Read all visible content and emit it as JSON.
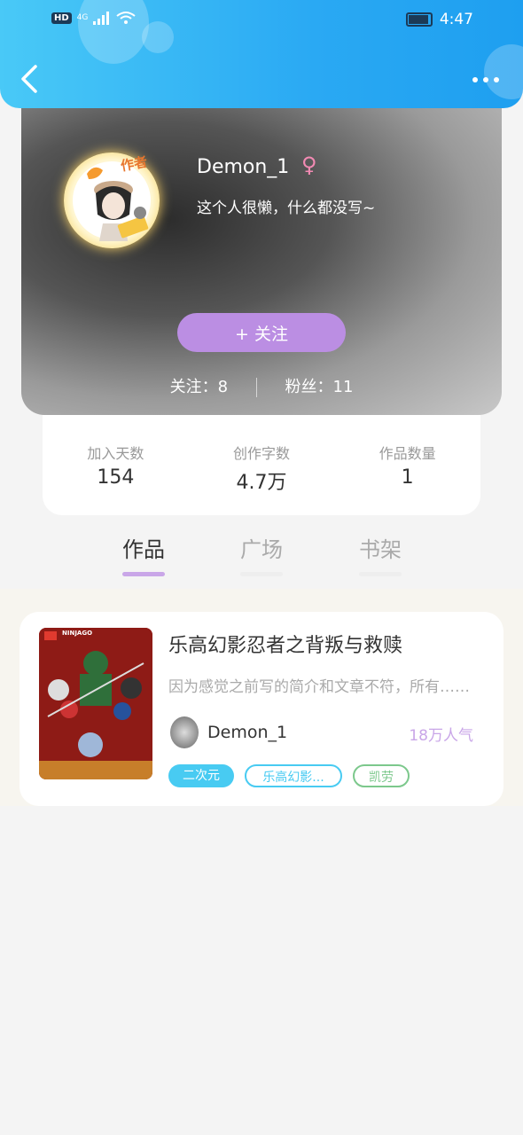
{
  "status_bar": {
    "hd": "HD",
    "network": "4G",
    "time": "4:47"
  },
  "header": {
    "back_icon": "chevron-left-icon",
    "more_icon": "more-dots-icon"
  },
  "profile": {
    "avatar_badge": "作者",
    "username": "Demon_1",
    "gender_symbol": "♀",
    "bio": "这个人很懒，什么都没写~",
    "follow_label": "+ 关注",
    "following_text": "关注：8",
    "followers_text": "粉丝：11"
  },
  "stats": [
    {
      "label": "加入天数",
      "value": "154"
    },
    {
      "label": "创作字数",
      "value": "4.7万"
    },
    {
      "label": "作品数量",
      "value": "1"
    }
  ],
  "tabs": [
    {
      "label": "作品",
      "active": true
    },
    {
      "label": "广场",
      "active": false
    },
    {
      "label": "书架",
      "active": false
    }
  ],
  "work": {
    "title": "乐高幻影忍者之背叛与救赎",
    "description": "因为感觉之前写的简介和文章不符，所有……",
    "cover_badge": "NINJAGO",
    "author": "Demon_1",
    "popularity": "18万人气",
    "tags": [
      "二次元",
      "乐高幻影...",
      "凯劳"
    ]
  },
  "colors": {
    "header": "#2aa9f3",
    "accent_purple": "#bb8ee3",
    "tag_blue": "#48cbf2",
    "tag_green": "#7cc88c"
  }
}
